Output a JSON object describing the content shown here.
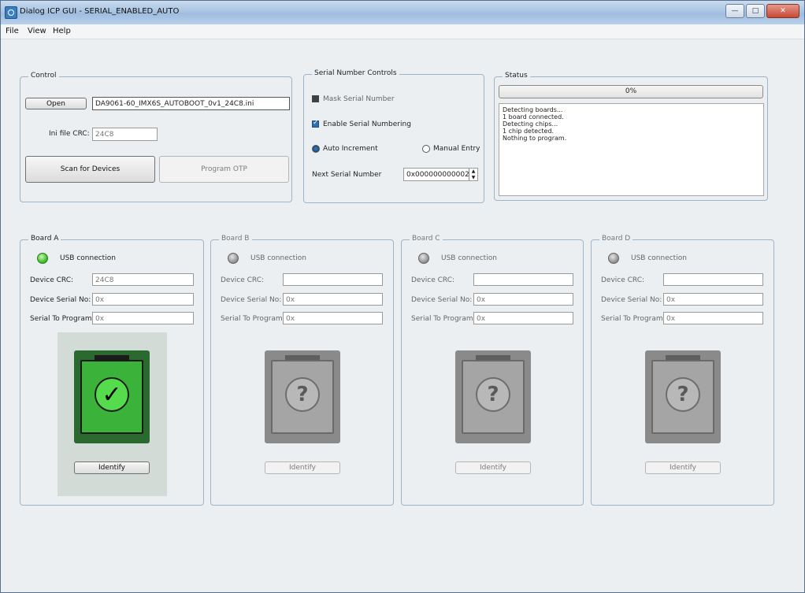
{
  "window": {
    "title": "Dialog ICP GUI - SERIAL_ENABLED_AUTO"
  },
  "menu": [
    "File",
    "View",
    "Help"
  ],
  "control": {
    "legend": "Control",
    "open_label": "Open",
    "ini_file": "DA9061-60_IMX6S_AUTOBOOT_0v1_24C8.ini",
    "crc_label": "Ini file CRC:",
    "crc_value": "24C8",
    "scan_label": "Scan for Devices",
    "program_label": "Program OTP"
  },
  "serial": {
    "legend": "Serial Number Controls",
    "mask_label": "Mask Serial Number",
    "enable_label": "Enable Serial Numbering",
    "auto_label": "Auto Increment",
    "manual_label": "Manual Entry",
    "next_label": "Next Serial Number",
    "next_value": "0x000000000002",
    "enable_checked": true,
    "auto_selected": true
  },
  "status": {
    "legend": "Status",
    "progress_text": "0%",
    "progress": 0,
    "log": [
      "Detecting boards...",
      "1 board connected.",
      "Detecting chips...",
      "1 chip detected.",
      "Nothing to program."
    ]
  },
  "boards": [
    {
      "legend": "Board A",
      "usb_label": "USB connection",
      "connected": true,
      "crc_label": "Device CRC:",
      "crc": "24C8",
      "serial_label": "Device Serial No:",
      "serial": "0x",
      "program_label": "Serial To Program:",
      "program": "0x",
      "identify_label": "Identify",
      "icon": "chip-check-icon"
    },
    {
      "legend": "Board B",
      "usb_label": "USB connection",
      "connected": false,
      "crc_label": "Device CRC:",
      "crc": "",
      "serial_label": "Device Serial No:",
      "serial": "0x",
      "program_label": "Serial To Program:",
      "program": "0x",
      "identify_label": "Identify",
      "icon": "chip-question-icon"
    },
    {
      "legend": "Board C",
      "usb_label": "USB connection",
      "connected": false,
      "crc_label": "Device CRC:",
      "crc": "",
      "serial_label": "Device Serial No:",
      "serial": "0x",
      "program_label": "Serial To Program:",
      "program": "0x",
      "identify_label": "Identify",
      "icon": "chip-question-icon"
    },
    {
      "legend": "Board D",
      "usb_label": "USB connection",
      "connected": false,
      "crc_label": "Device CRC:",
      "crc": "",
      "serial_label": "Device Serial No:",
      "serial": "0x",
      "program_label": "Serial To Program:",
      "program": "0x",
      "identify_label": "Identify",
      "icon": "chip-question-icon"
    }
  ],
  "colors": {
    "accent": "#2e6db0",
    "ok_green": "#44c22e",
    "frame": "#9db4c9"
  }
}
